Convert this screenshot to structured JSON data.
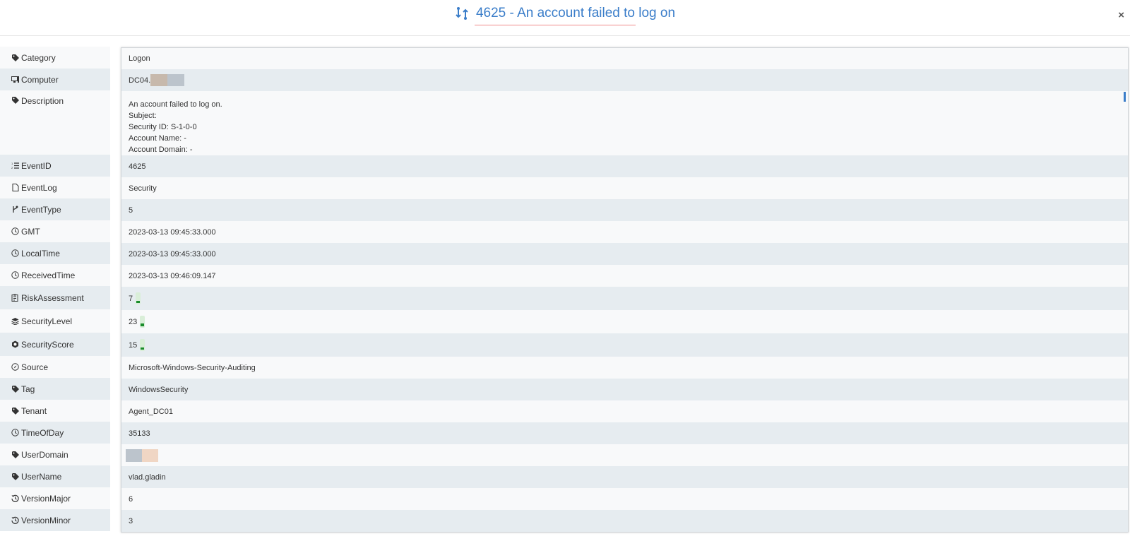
{
  "header": {
    "title": "4625 - An account failed to log on",
    "close_label": "×"
  },
  "colors": {
    "accent": "#3a7dc9",
    "meter_fill": "#1a8c2b"
  },
  "rows": [
    {
      "label": "Category",
      "icon": "tag-icon",
      "value": "Logon"
    },
    {
      "label": "Computer",
      "icon": "computer-icon",
      "value": "DC04."
    },
    {
      "label": "Description",
      "icon": "tag-icon",
      "lines": [
        "An account failed to log on.",
        "",
        "Subject:",
        "Security ID: S-1-0-0",
        "Account Name: -",
        "Account Domain: -"
      ]
    },
    {
      "label": "EventID",
      "icon": "list-icon",
      "value": "4625"
    },
    {
      "label": "EventLog",
      "icon": "file-icon",
      "value": "Security"
    },
    {
      "label": "EventType",
      "icon": "branch-icon",
      "value": "5"
    },
    {
      "label": "GMT",
      "icon": "clock-icon",
      "value": "2023-03-13 09:45:33.000"
    },
    {
      "label": "LocalTime",
      "icon": "clock-icon",
      "value": "2023-03-13 09:45:33.000"
    },
    {
      "label": "ReceivedTime",
      "icon": "clock-icon",
      "value": "2023-03-13 09:46:09.147"
    },
    {
      "label": "RiskAssessment",
      "icon": "clipboard-icon",
      "value": "7",
      "meter": 0.07
    },
    {
      "label": "SecurityLevel",
      "icon": "layers-icon",
      "value": "23",
      "meter": 0.23
    },
    {
      "label": "SecurityScore",
      "icon": "hexagon-icon",
      "value": "15",
      "meter": 0.15
    },
    {
      "label": "Source",
      "icon": "compass-icon",
      "value": "Microsoft-Windows-Security-Auditing"
    },
    {
      "label": "Tag",
      "icon": "tag-icon",
      "value": "WindowsSecurity"
    },
    {
      "label": "Tenant",
      "icon": "tag-icon",
      "value": "Agent_DC01"
    },
    {
      "label": "TimeOfDay",
      "icon": "clock-icon",
      "value": "35133"
    },
    {
      "label": "UserDomain",
      "icon": "tag-icon",
      "value": ""
    },
    {
      "label": "UserName",
      "icon": "tag-icon",
      "value": "vlad.gladin"
    },
    {
      "label": "VersionMajor",
      "icon": "history-icon",
      "value": "6"
    },
    {
      "label": "VersionMinor",
      "icon": "history-icon",
      "value": "3"
    }
  ]
}
